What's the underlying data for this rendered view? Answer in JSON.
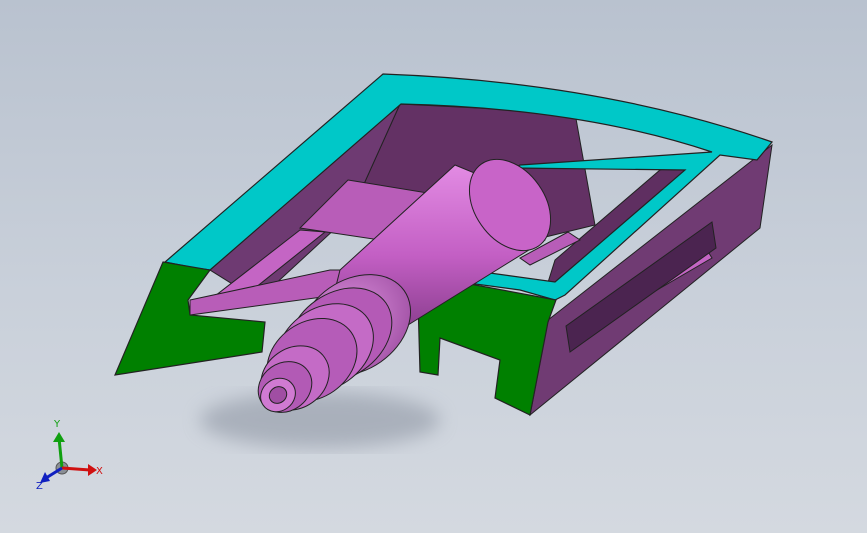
{
  "viewport": {
    "background_top": "#b9c2cf",
    "background_bottom": "#d4d9e0"
  },
  "model": {
    "colors": {
      "frame_top": "#00c8c8",
      "frame_section": "#008000",
      "body": "#703b73",
      "spindle": "#c35fc4",
      "rail": "#b85db8"
    }
  },
  "triad": {
    "x_label": "X",
    "y_label": "Y",
    "z_label": "Z",
    "x_color": "#d01010",
    "y_color": "#10a010",
    "z_color": "#1020c0"
  }
}
